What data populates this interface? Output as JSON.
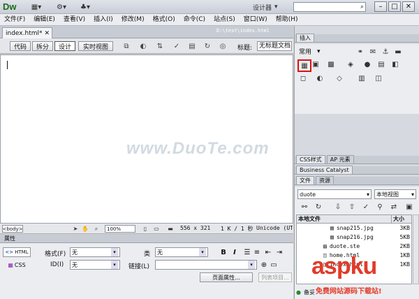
{
  "app": {
    "logo": "Dw",
    "workspace": "设计器"
  },
  "menubar": [
    "文件(F)",
    "编辑(E)",
    "查看(V)",
    "插入(I)",
    "修改(M)",
    "格式(O)",
    "命令(C)",
    "站点(S)",
    "窗口(W)",
    "帮助(H)"
  ],
  "document": {
    "tab_label": "index.html*",
    "path": "D:\\test\\index.html"
  },
  "doc_toolbar": {
    "views": [
      "代码",
      "拆分",
      "设计",
      "实时视图"
    ],
    "title_label": "标题:",
    "title_value": "无标题文档"
  },
  "statusbar": {
    "tag": "<body>",
    "zoom": "100%",
    "window_size": "556 x 321",
    "download": "1 K / 1 秒",
    "encoding": "Unicode (UTF-8)"
  },
  "watermark_text": "www.DuoTe.com",
  "properties": {
    "header": "属性",
    "html_label": "HTML",
    "css_label": "CSS",
    "format_label": "格式(F)",
    "format_value": "无",
    "id_label": "ID(I)",
    "id_value": "无",
    "class_label": "类",
    "class_value": "无",
    "link_label": "链接(L)",
    "bold": "B",
    "italic": "I",
    "page_props_btn": "页面属性...",
    "list_item_btn": "列表项目..."
  },
  "insert_panel": {
    "tab": "插入",
    "category": "常用"
  },
  "css_panel": {
    "tabs": [
      "CSS样式",
      "AP 元素"
    ]
  },
  "bc_panel": {
    "tab": "Business Catalyst"
  },
  "files_panel": {
    "tabs": [
      "文件",
      "资源"
    ],
    "site": "duote",
    "view": "本地视图",
    "columns": [
      "本地文件",
      "大小"
    ],
    "files": [
      {
        "name": "snap215.jpg",
        "size": "3KB"
      },
      {
        "name": "snap216.jpg",
        "size": "5KB"
      },
      {
        "name": "duote.ste",
        "size": "2KB"
      },
      {
        "name": "home.html",
        "size": "1KB"
      },
      {
        "name": "index.html",
        "size": "1KB"
      }
    ],
    "status": "备妥"
  },
  "site_watermark": {
    "logo": "aspku",
    "sub": "免费网站源码下载站!"
  }
}
